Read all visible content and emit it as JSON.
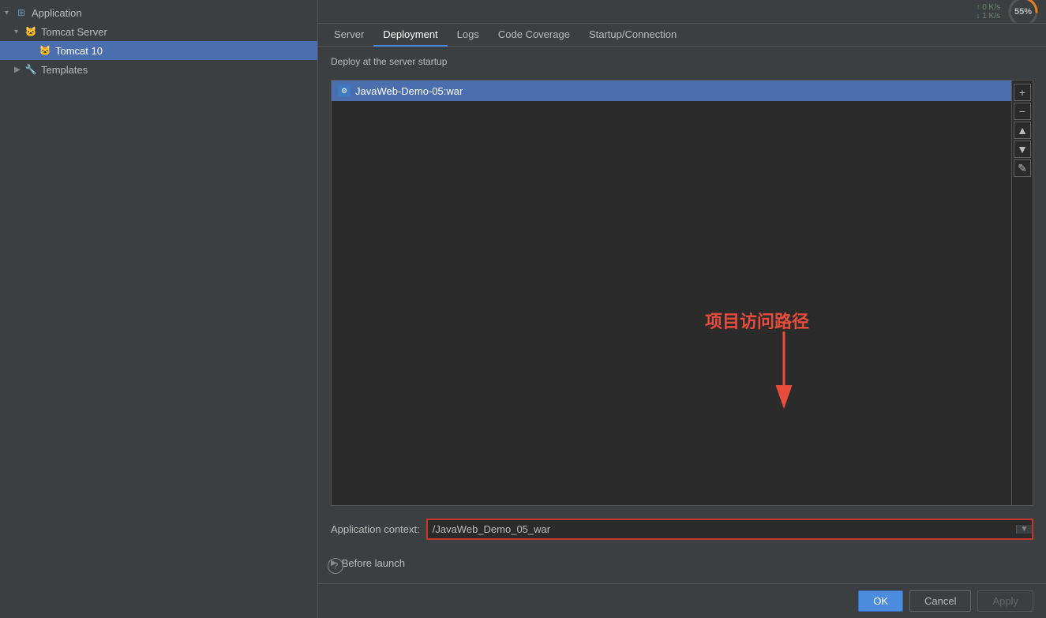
{
  "sidebar": {
    "items": [
      {
        "id": "application",
        "label": "Application",
        "level": 0,
        "expanded": true,
        "icon": "app-icon",
        "hasArrow": true
      },
      {
        "id": "tomcat-server",
        "label": "Tomcat Server",
        "level": 1,
        "expanded": true,
        "icon": "tomcat-icon",
        "hasArrow": true
      },
      {
        "id": "tomcat-10",
        "label": "Tomcat 10",
        "level": 2,
        "icon": "tomcat-icon",
        "selected": true
      },
      {
        "id": "templates",
        "label": "Templates",
        "level": 1,
        "icon": "wrench-icon",
        "hasArrow": true
      }
    ]
  },
  "tabs": [
    {
      "id": "server",
      "label": "Server"
    },
    {
      "id": "deployment",
      "label": "Deployment",
      "active": true
    },
    {
      "id": "logs",
      "label": "Logs"
    },
    {
      "id": "code-coverage",
      "label": "Code Coverage"
    },
    {
      "id": "startup-connection",
      "label": "Startup/Connection"
    }
  ],
  "panel": {
    "deploy_label": "Deploy at the server startup",
    "deployment_items": [
      {
        "id": "javaweb-demo",
        "label": "JavaWeb-Demo-05:war",
        "selected": true
      }
    ],
    "context_label": "Application context:",
    "context_value": "/JavaWeb_Demo_05_war",
    "before_launch_label": "Before launch",
    "annotation_text": "项目访问路径"
  },
  "network": {
    "up": "↑ 0  K/s",
    "down": "↓ 1  K/s",
    "cpu_percent": "55%",
    "cpu_value": 55
  },
  "buttons": {
    "ok": "OK",
    "cancel": "Cancel",
    "apply": "Apply"
  },
  "list_buttons": {
    "add": "+",
    "remove": "−",
    "up": "▲",
    "down": "▼",
    "edit": "✎"
  },
  "help": "?"
}
